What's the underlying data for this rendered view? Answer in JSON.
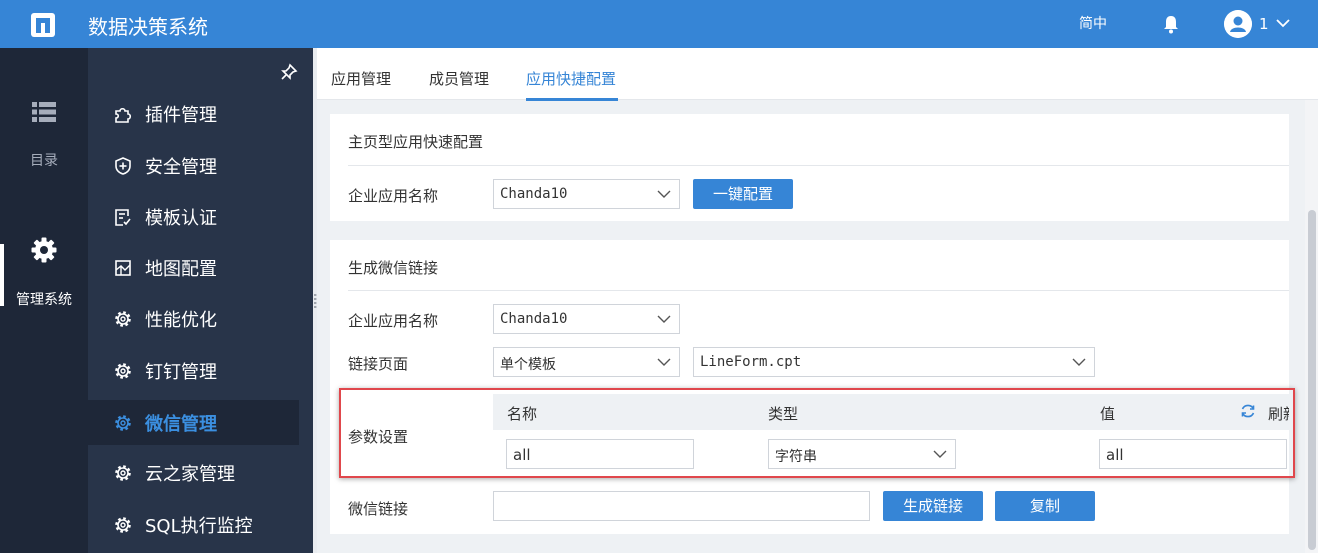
{
  "header": {
    "app_title": "数据决策系统",
    "language": "简中",
    "username": "1"
  },
  "rail": {
    "directory_label": "目录",
    "management_label": "管理系统"
  },
  "menu": [
    {
      "label": "插件管理",
      "icon": "plugin-icon"
    },
    {
      "label": "安全管理",
      "icon": "shield-icon"
    },
    {
      "label": "模板认证",
      "icon": "template-cert-icon"
    },
    {
      "label": "地图配置",
      "icon": "map-icon"
    },
    {
      "label": "性能优化",
      "icon": "gear-icon"
    },
    {
      "label": "钉钉管理",
      "icon": "gear-icon"
    },
    {
      "label": "微信管理",
      "icon": "gear-icon",
      "active": true
    },
    {
      "label": "云之家管理",
      "icon": "gear-icon"
    },
    {
      "label": "SQL执行监控",
      "icon": "gear-icon"
    }
  ],
  "tabs": [
    {
      "label": "应用管理"
    },
    {
      "label": "成员管理"
    },
    {
      "label": "应用快捷配置",
      "active": true
    }
  ],
  "quick_config": {
    "title": "主页型应用快速配置",
    "app_name_label": "企业应用名称",
    "app_name_value": "Chanda10",
    "one_click_button": "一键配置"
  },
  "wechat_link": {
    "title": "生成微信链接",
    "app_name_label": "企业应用名称",
    "app_name_value": "Chanda10",
    "link_page_label": "链接页面",
    "link_page_type": "单个模板",
    "link_page_file": "LineForm.cpt",
    "params_label": "参数设置",
    "params_columns": {
      "name": "名称",
      "type": "类型",
      "value": "值"
    },
    "refresh_label": "刷新",
    "param_row": {
      "name": "all",
      "type": "字符串",
      "value": "all"
    },
    "link_label": "微信链接",
    "link_value": "",
    "generate_button": "生成链接",
    "copy_button": "复制"
  },
  "colors": {
    "topbar": "#3685d6",
    "rail": "#1e2738",
    "sidebar": "#283449",
    "accent": "#3685d6",
    "highlight_border": "#e0474c"
  }
}
